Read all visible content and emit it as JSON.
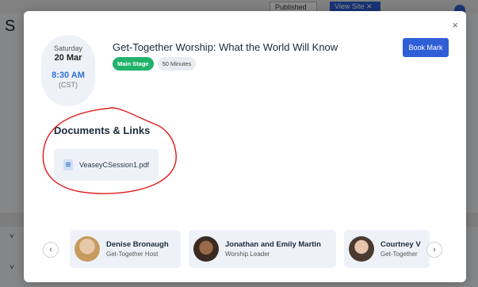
{
  "background": {
    "letter": "S",
    "published_label": "Published",
    "view_site_label": "View Site ✕",
    "chevron": "˅"
  },
  "modal": {
    "close_icon": "×",
    "date": {
      "day": "Saturday",
      "date": "20 Mar",
      "time": "8:30 AM",
      "timezone": "(CST)"
    },
    "title": "Get-Together Worship: What the World Will Know",
    "tags": {
      "stage": "Main Stage",
      "duration": "50 Minutes"
    },
    "bookmark_label": "Book Mark",
    "documents": {
      "heading": "Documents & Links",
      "files": [
        {
          "name": "VeaseyCSession1.pdf",
          "icon": "document-icon"
        }
      ]
    },
    "speakers": {
      "prev_icon": "‹",
      "next_icon": "›",
      "items": [
        {
          "name": "Denise Bronaugh",
          "role": "Get-Together Host"
        },
        {
          "name": "Jonathan and Emily Martin",
          "role": "Worship Leader"
        },
        {
          "name": "Courtney V",
          "role": "Get-Together"
        }
      ]
    }
  },
  "colors": {
    "accent": "#2f5fd6",
    "stage_tag": "#21b36b",
    "annotation": "#e01b1b"
  }
}
